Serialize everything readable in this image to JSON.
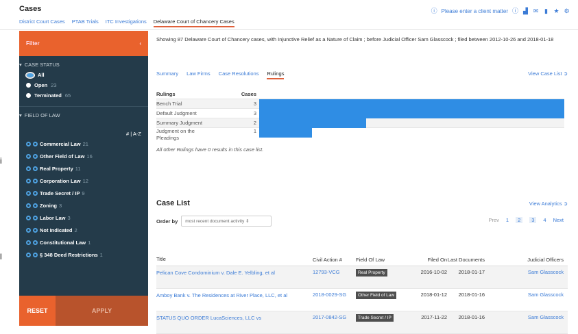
{
  "header": {
    "title": "Cases",
    "tabs": [
      {
        "label": "District Court Cases"
      },
      {
        "label": "PTAB Trials"
      },
      {
        "label": "ITC Investigations"
      },
      {
        "label": "Delaware Court of Chancery Cases"
      }
    ],
    "client_matter": "Please enter a client matter"
  },
  "sidebar": {
    "filter_label": "Filter",
    "case_status_label": "CASE STATUS",
    "statuses": [
      {
        "label": "All",
        "count": ""
      },
      {
        "label": "Open",
        "count": "23"
      },
      {
        "label": "Terminated",
        "count": "65"
      }
    ],
    "field_of_law_label": "FIELD OF LAW",
    "sort_label": "# | A-Z",
    "laws": [
      {
        "label": "Commercial Law",
        "count": "21"
      },
      {
        "label": "Other Field of Law",
        "count": "16"
      },
      {
        "label": "Real Property",
        "count": "11"
      },
      {
        "label": "Corporation Law",
        "count": "12"
      },
      {
        "label": "Trade Secret / IP",
        "count": "9"
      },
      {
        "label": "Zoning",
        "count": "3"
      },
      {
        "label": "Labor Law",
        "count": "3"
      },
      {
        "label": "Not Indicated",
        "count": "2"
      },
      {
        "label": "Constitutional Law",
        "count": "1"
      },
      {
        "label": "§ 348 Deed Restrictions",
        "count": "1"
      }
    ],
    "reset_label": "RESET",
    "apply_label": "APPLY"
  },
  "main": {
    "summary": "Showing 87 Delaware Court of Chancery cases,  with Injunctive Relief as a Nature of Claim ;  before Judicial Officer Sam Glasscock ;  filed between 2012-10-26 and 2018-01-18",
    "subtabs": [
      {
        "label": "Summary"
      },
      {
        "label": "Law Firms"
      },
      {
        "label": "Case Resolutions"
      },
      {
        "label": "Rulings"
      }
    ],
    "view_case_list": "View Case List",
    "rulings_header": "Rulings",
    "cases_header": "Cases",
    "rulings": [
      {
        "label": "Bench Trial",
        "count": "3",
        "value": 3
      },
      {
        "label": "Default Judgment",
        "count": "3",
        "value": 3
      },
      {
        "label": "Summary Judgment",
        "count": "2",
        "value": 1.05
      },
      {
        "label": "Judgment on the Pleadings",
        "count": "1",
        "value": 0.52
      }
    ],
    "rulings_note": "All other Rulings have 0 results in this case list.",
    "case_list_label": "Case List",
    "view_analytics": "View Analytics",
    "order_by_label": "Order by",
    "order_by_value": "most recent document activity",
    "pager": {
      "prev": "Prev",
      "pages": [
        "1",
        "2",
        "3",
        "4"
      ],
      "next": "Next"
    },
    "columns": [
      "Title",
      "Civil Action #",
      "Field Of Law",
      "Filed On",
      "Last Documents",
      "Judicial Officers"
    ],
    "cases": [
      {
        "title": "Pelican Cove Condominium v. Dale E. Yelbling, et al",
        "action": "12793-VCG",
        "field": "Real Property",
        "filed": "2016-10-02",
        "last": "2018-01-17",
        "officer": "Sam Glasscock"
      },
      {
        "title": "Amboy Bank v. The Residences at River Place, LLC, et al",
        "action": "2018-0029-SG",
        "field": "Other Field of Law",
        "filed": "2018-01-12",
        "last": "2018-01-16",
        "officer": "Sam Glasscock"
      },
      {
        "title": "STATUS QUO ORDER LucaSciences, LLC vs",
        "action": "2017-0842-SG",
        "field": "Trade Secret / IP",
        "filed": "2017-11-22",
        "last": "2018-01-16",
        "officer": "Sam Glasscock"
      }
    ]
  },
  "colors": {
    "accent": "#e9622d",
    "sidebar": "#243b4a",
    "bar": "#2f8de4",
    "link": "#3b7bd6"
  }
}
